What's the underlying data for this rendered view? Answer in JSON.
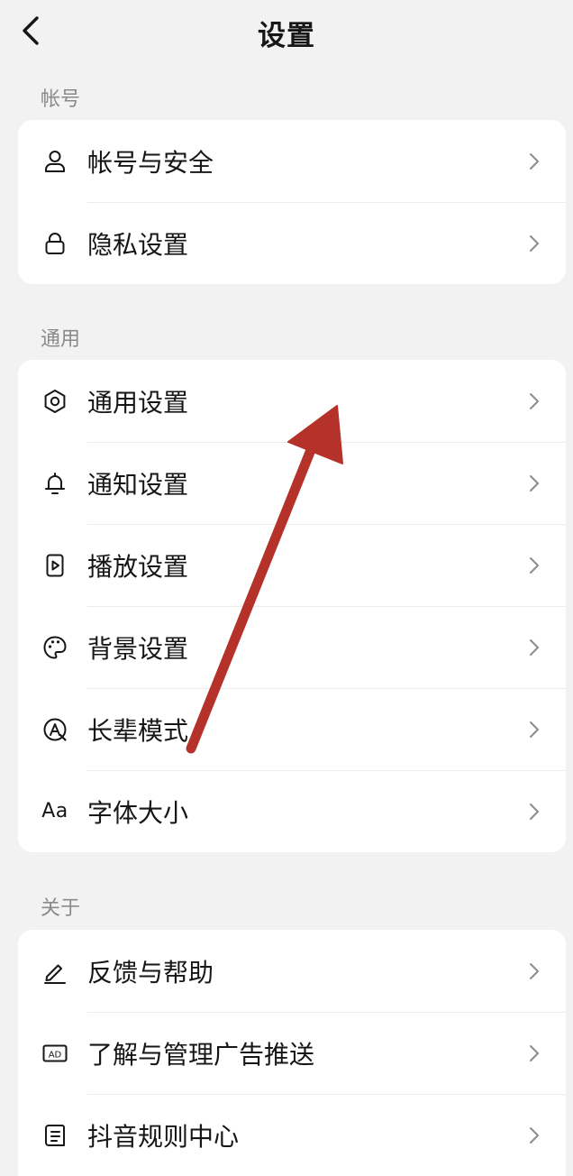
{
  "header": {
    "title": "设置",
    "back_icon": "back-chevron-icon"
  },
  "sections": [
    {
      "label": "帐号",
      "items": [
        {
          "label": "帐号与安全",
          "icon": "person-icon"
        },
        {
          "label": "隐私设置",
          "icon": "lock-icon"
        }
      ]
    },
    {
      "label": "通用",
      "items": [
        {
          "label": "通用设置",
          "icon": "gear-icon"
        },
        {
          "label": "通知设置",
          "icon": "bell-icon"
        },
        {
          "label": "播放设置",
          "icon": "play-icon"
        },
        {
          "label": "背景设置",
          "icon": "palette-icon"
        },
        {
          "label": "长辈模式",
          "icon": "elder-mode-icon"
        },
        {
          "label": "字体大小",
          "icon": "font-size-icon",
          "icon_text": "Aa"
        }
      ]
    },
    {
      "label": "关于",
      "items": [
        {
          "label": "反馈与帮助",
          "icon": "pen-icon"
        },
        {
          "label": "了解与管理广告推送",
          "icon": "ad-icon",
          "icon_text": "AD"
        },
        {
          "label": "抖音规则中心",
          "icon": "rules-doc-icon"
        }
      ]
    }
  ],
  "annotation": {
    "type": "arrow",
    "color": "#b5322a"
  }
}
